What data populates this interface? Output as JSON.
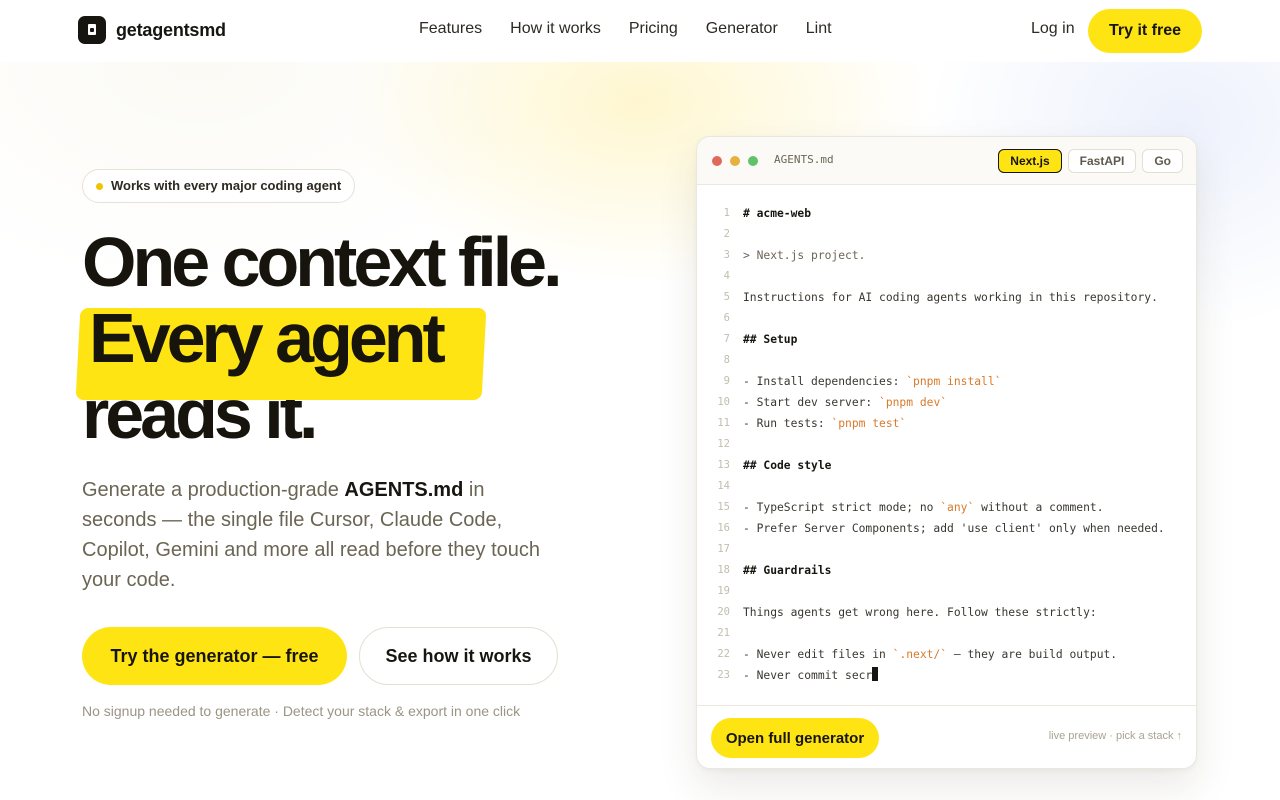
{
  "nav": {
    "brand": "getagentsmd",
    "links": [
      "Features",
      "How it works",
      "Pricing",
      "Generator",
      "Lint"
    ],
    "login": "Log in",
    "cta": "Try it free"
  },
  "hero": {
    "pill": "Works with every major coding agent",
    "headline": [
      "One context file.",
      "Every agent",
      "reads it."
    ],
    "sub_pre": "Generate a production-grade ",
    "sub_strong": "AGENTS.md",
    "sub_post": " in seconds — the single file Cursor, Claude Code, Copilot, Gemini and more all read before they touch your code.",
    "cta_primary": "Try the generator — free",
    "cta_secondary": "See how it works",
    "fine_print": "No signup needed to generate · Detect your stack & export in one click"
  },
  "editor": {
    "filename": "AGENTS.md",
    "tabs": [
      {
        "label": "Next.js",
        "active": true
      },
      {
        "label": "FastAPI",
        "active": false
      },
      {
        "label": "Go",
        "active": false
      }
    ],
    "lines": [
      {
        "n": "1",
        "text": "# acme-web"
      },
      {
        "n": "2",
        "text": ""
      },
      {
        "n": "3",
        "text": "> Next.js project."
      },
      {
        "n": "4",
        "text": ""
      },
      {
        "n": "5",
        "text": "Instructions for AI coding agents working in this repository."
      },
      {
        "n": "6",
        "text": ""
      },
      {
        "n": "7",
        "text": "## Setup"
      },
      {
        "n": "8",
        "text": ""
      },
      {
        "n": "9",
        "text": "- Install dependencies: `pnpm install`"
      },
      {
        "n": "10",
        "text": "- Start dev server: `pnpm dev`"
      },
      {
        "n": "11",
        "text": "- Run tests: `pnpm test`"
      },
      {
        "n": "12",
        "text": ""
      },
      {
        "n": "13",
        "text": "## Code style"
      },
      {
        "n": "14",
        "text": ""
      },
      {
        "n": "15",
        "text": "- TypeScript strict mode; no `any` without a comment."
      },
      {
        "n": "16",
        "text": "- Prefer Server Components; add 'use client' only when needed."
      },
      {
        "n": "17",
        "text": ""
      },
      {
        "n": "18",
        "text": "## Guardrails"
      },
      {
        "n": "19",
        "text": ""
      },
      {
        "n": "20",
        "text": "Things agents get wrong here. Follow these strictly:"
      },
      {
        "n": "21",
        "text": ""
      },
      {
        "n": "22",
        "text": "- Never edit files in `.next/` — they are build output."
      },
      {
        "n": "23",
        "text": "- Never commit secr"
      }
    ],
    "open_button": "Open full generator",
    "hint": "live preview · pick a stack ↑"
  },
  "colors": {
    "accent": "#ffe414",
    "ink": "#17150f",
    "code_tick": "#d97a2b"
  }
}
